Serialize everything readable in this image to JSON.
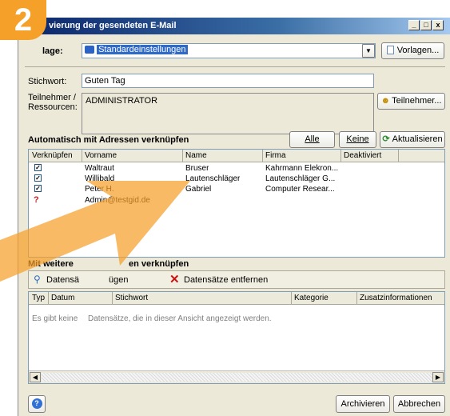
{
  "window": {
    "title": "vierung der gesendeten E-Mail",
    "minimize": "_",
    "maximize": "□",
    "close": "x"
  },
  "step_badge": "2",
  "template": {
    "label": "Vorlage:",
    "label_visible": "lage:",
    "value": "Standardeinstellungen",
    "button": "Vorlagen..."
  },
  "keyword": {
    "label": "Stichwort:",
    "value": "Guten Tag"
  },
  "participants": {
    "label_line1": "Teilnehmer /",
    "label_line2": "Ressourcen:",
    "value": "ADMINISTRATOR",
    "button": "Teilnehmer..."
  },
  "auto_link": {
    "title": "Automatisch mit Adressen verknüpfen",
    "btn_all": "Alle",
    "btn_none": "Keine",
    "btn_refresh": "Aktualisieren",
    "columns": [
      "Verknüpfen",
      "Vorname",
      "Name",
      "Firma",
      "Deaktiviert"
    ],
    "rows": [
      {
        "checked": "✓",
        "first": "Waltraut",
        "last": "Bruser",
        "company": "Kahrmann Elekron..."
      },
      {
        "checked": "✓",
        "first": "Willibald",
        "last": "Lautenschläger",
        "company": "Lautenschläger G..."
      },
      {
        "checked": "✓",
        "first": "Peter H.",
        "last": "Gabriel",
        "company": "Computer Resear..."
      },
      {
        "checked": "",
        "first": "Admin@testgid.de",
        "last": "",
        "company": ""
      }
    ]
  },
  "more_link": {
    "title_left": "Mit weitere",
    "title_right": "en verknüpfen",
    "btn_add_left": "Datensä",
    "btn_add_right": "ügen",
    "btn_remove": "Datensätze entfernen",
    "columns": [
      "Typ",
      "Datum",
      "Stichwort",
      "Kategorie",
      "Zusatzinformationen"
    ],
    "empty_left": "Es gibt keine ",
    "empty_right": "Datensätze, die in dieser Ansicht angezeigt werden."
  },
  "footer": {
    "btn_archive": "Archivieren",
    "btn_cancel": "Abbrechen"
  },
  "colors": {
    "badge": "#f5a029",
    "titlebar": "#0a246a",
    "remove_x": "#cc1111"
  }
}
